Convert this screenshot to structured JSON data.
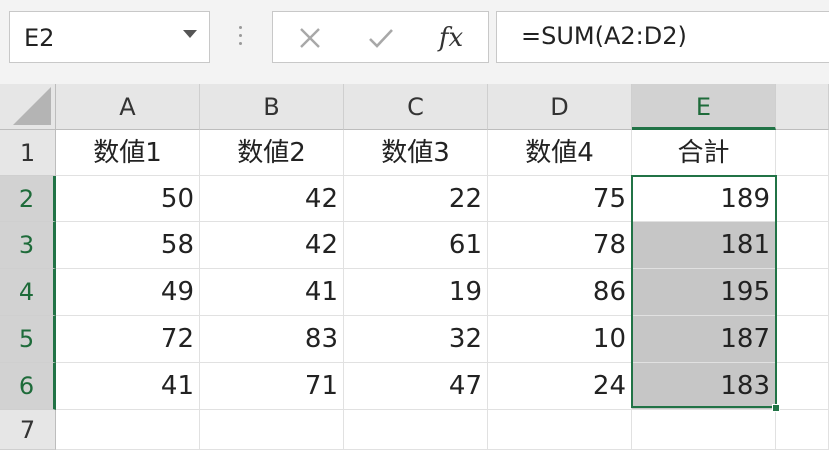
{
  "formula_bar": {
    "name_box": "E2",
    "formula": "=SUM(A2:D2)",
    "fx_label": "fx"
  },
  "columns": [
    "A",
    "B",
    "C",
    "D",
    "E"
  ],
  "rows": [
    "1",
    "2",
    "3",
    "4",
    "5",
    "6",
    "7"
  ],
  "sheet": {
    "headers": [
      "数値1",
      "数値2",
      "数値3",
      "数値4",
      "合計"
    ],
    "data": [
      [
        "50",
        "42",
        "22",
        "75",
        "189"
      ],
      [
        "58",
        "42",
        "61",
        "78",
        "181"
      ],
      [
        "49",
        "41",
        "19",
        "86",
        "195"
      ],
      [
        "72",
        "83",
        "32",
        "10",
        "187"
      ],
      [
        "41",
        "71",
        "47",
        "24",
        "183"
      ]
    ]
  },
  "selection": {
    "range": "E2:E6",
    "active_cell": "E2"
  },
  "colors": {
    "selection_accent": "#217346",
    "selected_fill": "#c6c6c6",
    "header_fill": "#e6e6e6"
  },
  "icons": {
    "cancel": "close-icon",
    "enter": "check-icon",
    "function": "fx-icon",
    "name_box_dropdown": "chevron-down-icon"
  }
}
